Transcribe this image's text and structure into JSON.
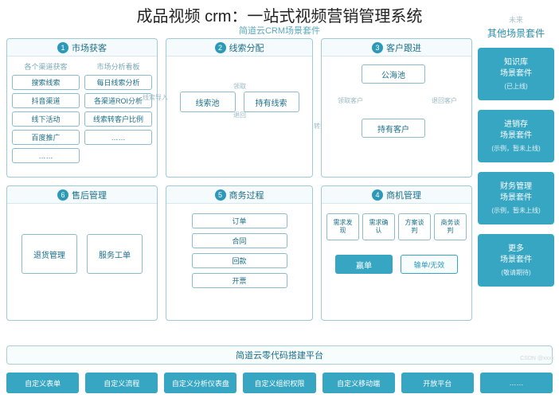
{
  "title": "成品视频 crm：一站式视频营销管理系统",
  "subtitle": "简道云CRM场景套件",
  "panels": {
    "p1": {
      "num": "1",
      "title": "市场获客",
      "colA_head": "各个渠道获客",
      "colA": [
        "搜索线索",
        "抖音渠道",
        "线下活动",
        "百度推广",
        "……"
      ],
      "colB_head": "市场分析看板",
      "colB": [
        "每日线索分析",
        "各渠道ROI分析",
        "线索转客户比例",
        "……"
      ]
    },
    "p2": {
      "num": "2",
      "title": "线索分配",
      "left": "线索池",
      "right": "持有线索",
      "flow_in": "线索导入",
      "flow_top": "领取",
      "flow_bot": "退回",
      "flow_out": "转换为"
    },
    "p3": {
      "num": "3",
      "title": "客户跟进",
      "top": "公海池",
      "bottom": "持有客户",
      "flow_l": "领取客户",
      "flow_r": "退回客户"
    },
    "p4": {
      "num": "4",
      "title": "商机管理",
      "top": [
        "需求发现",
        "需求确认",
        "方案谈判",
        "商务谈判"
      ],
      "win": "赢单",
      "lose": "输单/无效"
    },
    "p5": {
      "num": "5",
      "title": "商务过程",
      "items": [
        "订单",
        "合同",
        "回款",
        "开票"
      ]
    },
    "p6": {
      "num": "6",
      "title": "售后管理",
      "a": "退货管理",
      "b": "服务工单"
    }
  },
  "right": {
    "head": "未来",
    "title": "其他场景套件",
    "cards": [
      {
        "l1a": "知识库",
        "l1b": "场景套件",
        "l2": "(已上线)"
      },
      {
        "l1a": "进销存",
        "l1b": "场景套件",
        "l2": "(示例，暂未上线)"
      },
      {
        "l1a": "财务管理",
        "l1b": "场景套件",
        "l2": "(示例，暂未上线)"
      },
      {
        "l1a": "更多",
        "l1b": "场景套件",
        "l2": "(敬请期待)"
      }
    ]
  },
  "platform": "简道云零代码搭建平台",
  "bottom": [
    "自定义表单",
    "自定义流程",
    "自定义分析仪表盘",
    "自定义组织权限",
    "自定义移动端",
    "开放平台",
    "……"
  ],
  "watermark": "CSDN @xxxx"
}
